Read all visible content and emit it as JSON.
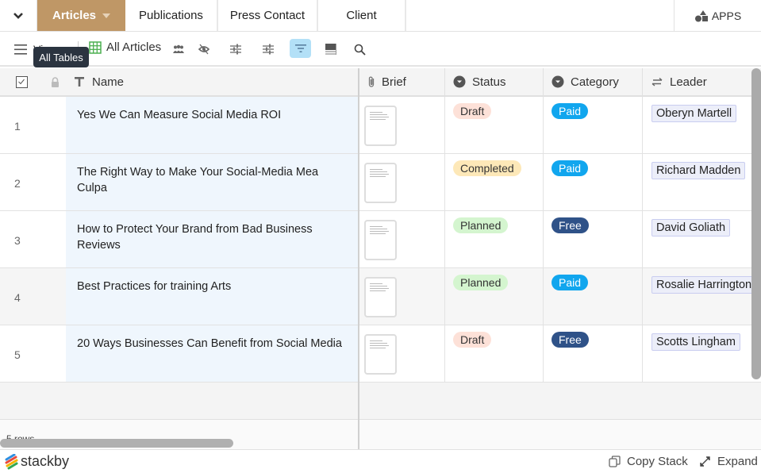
{
  "topbar": {
    "tabs": [
      {
        "label": "Articles",
        "active": true
      },
      {
        "label": "Publications",
        "active": false
      },
      {
        "label": "Press Contact",
        "active": false
      },
      {
        "label": "Client",
        "active": false
      }
    ],
    "apps_label": "APPS"
  },
  "toolbar": {
    "views_label": "Views",
    "view_name": "All Articles",
    "tooltip": "All Tables",
    "icons": [
      "menu-icon",
      "grid-icon",
      "users-icon",
      "hide-fields-icon",
      "filter-sliders-icon",
      "group-sliders-icon",
      "sort-filter-icon",
      "row-height-icon",
      "search-icon"
    ]
  },
  "columns": {
    "name": "Name",
    "brief": "Brief",
    "status": "Status",
    "category": "Category",
    "leader": "Leader"
  },
  "colors": {
    "active_tab": "#bf9766",
    "status_draft_bg": "#fde1d8",
    "status_completed_bg": "#fde8b8",
    "status_planned_bg": "#d4f5cf",
    "category_paid_bg": "#11a6ee",
    "category_free_bg": "#2f5288"
  },
  "rows": [
    {
      "num": "1",
      "name": "Yes We Can Measure Social Media ROI",
      "status": "Draft",
      "category": "Paid",
      "leader": "Oberyn Martell"
    },
    {
      "num": "2",
      "name": "The Right Way to Make Your Social-Media Mea Culpa",
      "status": "Completed",
      "category": "Paid",
      "leader": "Richard Madden"
    },
    {
      "num": "3",
      "name": "How to Protect Your Brand from Bad Business Reviews",
      "status": "Planned",
      "category": "Free",
      "leader": "David Goliath"
    },
    {
      "num": "4",
      "name": "Best Practices for training Arts",
      "status": "Planned",
      "category": "Paid",
      "leader": "Rosalie Harrington"
    },
    {
      "num": "5",
      "name": "20 Ways Businesses Can Benefit from Social Media",
      "status": "Draft",
      "category": "Free",
      "leader": "Scotts Lingham"
    }
  ],
  "footer": {
    "row_count": "5 rows",
    "logo_text": "stackby",
    "copy_stack": "Copy Stack",
    "expand": "Expand"
  }
}
